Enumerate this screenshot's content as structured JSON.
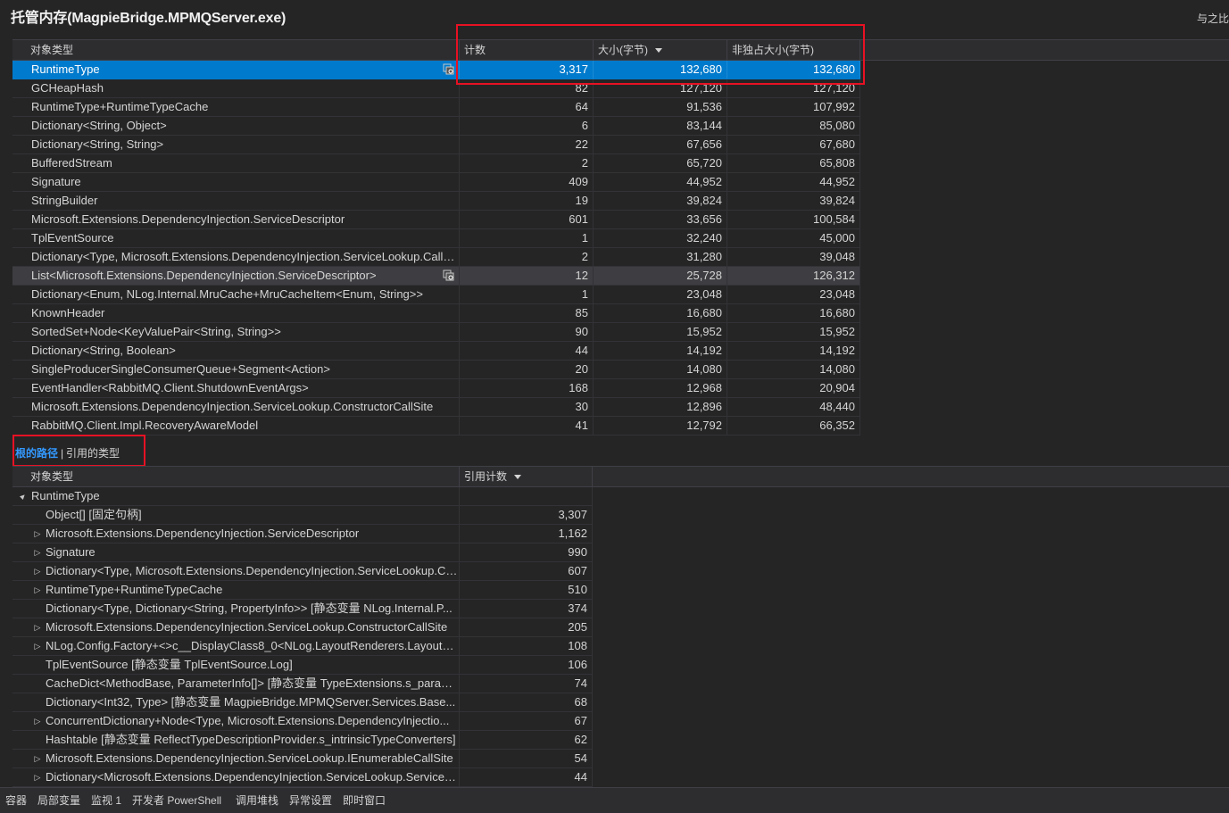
{
  "title": "托管内存(MagpieBridge.MPMQServer.exe)",
  "compare_link": "与之比较",
  "top_grid": {
    "columns": {
      "type": "对象类型",
      "count": "计数",
      "size": "大小(字节)",
      "inclusive": "非独占大小(字节)"
    },
    "rows": [
      {
        "name": "RuntimeType",
        "count": "3,317",
        "size": "132,680",
        "inclusive": "132,680"
      },
      {
        "name": "GCHeapHash",
        "count": "82",
        "size": "127,120",
        "inclusive": "127,120"
      },
      {
        "name": "RuntimeType+RuntimeTypeCache",
        "count": "64",
        "size": "91,536",
        "inclusive": "107,992"
      },
      {
        "name": "Dictionary<String, Object>",
        "count": "6",
        "size": "83,144",
        "inclusive": "85,080"
      },
      {
        "name": "Dictionary<String, String>",
        "count": "22",
        "size": "67,656",
        "inclusive": "67,680"
      },
      {
        "name": "BufferedStream",
        "count": "2",
        "size": "65,720",
        "inclusive": "65,808"
      },
      {
        "name": "Signature",
        "count": "409",
        "size": "44,952",
        "inclusive": "44,952"
      },
      {
        "name": "StringBuilder",
        "count": "19",
        "size": "39,824",
        "inclusive": "39,824"
      },
      {
        "name": "Microsoft.Extensions.DependencyInjection.ServiceDescriptor",
        "count": "601",
        "size": "33,656",
        "inclusive": "100,584"
      },
      {
        "name": "TplEventSource",
        "count": "1",
        "size": "32,240",
        "inclusive": "45,000"
      },
      {
        "name": "Dictionary<Type, Microsoft.Extensions.DependencyInjection.ServiceLookup.CallS...",
        "count": "2",
        "size": "31,280",
        "inclusive": "39,048"
      },
      {
        "name": "List<Microsoft.Extensions.DependencyInjection.ServiceDescriptor>",
        "count": "12",
        "size": "25,728",
        "inclusive": "126,312"
      },
      {
        "name": "Dictionary<Enum, NLog.Internal.MruCache+MruCacheItem<Enum, String>>",
        "count": "1",
        "size": "23,048",
        "inclusive": "23,048"
      },
      {
        "name": "KnownHeader",
        "count": "85",
        "size": "16,680",
        "inclusive": "16,680"
      },
      {
        "name": "SortedSet+Node<KeyValuePair<String, String>>",
        "count": "90",
        "size": "15,952",
        "inclusive": "15,952"
      },
      {
        "name": "Dictionary<String, Boolean>",
        "count": "44",
        "size": "14,192",
        "inclusive": "14,192"
      },
      {
        "name": "SingleProducerSingleConsumerQueue+Segment<Action>",
        "count": "20",
        "size": "14,080",
        "inclusive": "14,080"
      },
      {
        "name": "EventHandler<RabbitMQ.Client.ShutdownEventArgs>",
        "count": "168",
        "size": "12,968",
        "inclusive": "20,904"
      },
      {
        "name": "Microsoft.Extensions.DependencyInjection.ServiceLookup.ConstructorCallSite",
        "count": "30",
        "size": "12,896",
        "inclusive": "48,440"
      },
      {
        "name": "RabbitMQ.Client.Impl.RecoveryAwareModel",
        "count": "41",
        "size": "12,792",
        "inclusive": "66,352"
      }
    ]
  },
  "tabs": {
    "active": "根的路径",
    "separator": "|",
    "inactive": "引用的类型"
  },
  "bottom_grid": {
    "columns": {
      "type": "对象类型",
      "ref_count": "引用计数"
    },
    "rows": [
      {
        "name": "RuntimeType",
        "count": "",
        "expander": "▲",
        "level": 0
      },
      {
        "name": "Object[] [固定句柄]",
        "count": "3,307",
        "expander": "",
        "level": 1
      },
      {
        "name": "Microsoft.Extensions.DependencyInjection.ServiceDescriptor",
        "count": "1,162",
        "expander": "▷",
        "level": 1
      },
      {
        "name": "Signature",
        "count": "990",
        "expander": "▷",
        "level": 1
      },
      {
        "name": "Dictionary<Type, Microsoft.Extensions.DependencyInjection.ServiceLookup.Ca...",
        "count": "607",
        "expander": "▷",
        "level": 1
      },
      {
        "name": "RuntimeType+RuntimeTypeCache",
        "count": "510",
        "expander": "▷",
        "level": 1
      },
      {
        "name": "Dictionary<Type, Dictionary<String, PropertyInfo>> [静态变量 NLog.Internal.P...",
        "count": "374",
        "expander": "",
        "level": 1
      },
      {
        "name": "Microsoft.Extensions.DependencyInjection.ServiceLookup.ConstructorCallSite",
        "count": "205",
        "expander": "▷",
        "level": 1
      },
      {
        "name": "NLog.Config.Factory+<>c__DisplayClass8_0<NLog.LayoutRenderers.LayoutRe...",
        "count": "108",
        "expander": "▷",
        "level": 1
      },
      {
        "name": "TplEventSource [静态变量 TplEventSource.Log]",
        "count": "106",
        "expander": "",
        "level": 1
      },
      {
        "name": "CacheDict<MethodBase, ParameterInfo[]> [静态变量 TypeExtensions.s_paraml...",
        "count": "74",
        "expander": "",
        "level": 1
      },
      {
        "name": "Dictionary<Int32, Type> [静态变量 MagpieBridge.MPMQServer.Services.Base...",
        "count": "68",
        "expander": "",
        "level": 1
      },
      {
        "name": "ConcurrentDictionary+Node<Type, Microsoft.Extensions.DependencyInjectio...",
        "count": "67",
        "expander": "▷",
        "level": 1
      },
      {
        "name": "Hashtable [静态变量 ReflectTypeDescriptionProvider.s_intrinsicTypeConverters]",
        "count": "62",
        "expander": "",
        "level": 1
      },
      {
        "name": "Microsoft.Extensions.DependencyInjection.ServiceLookup.IEnumerableCallSite",
        "count": "54",
        "expander": "▷",
        "level": 1
      },
      {
        "name": "Dictionary<Microsoft.Extensions.DependencyInjection.ServiceLookup.ServiceC...",
        "count": "44",
        "expander": "▷",
        "level": 1
      }
    ]
  },
  "statusbar": [
    "容器",
    "局部变量",
    "监视 1",
    "开发者 PowerShell",
    "调用堆栈",
    "异常设置",
    "即时窗口"
  ],
  "icons": {
    "row_peek": "instances-icon"
  },
  "colors": {
    "background": "#252526",
    "selection": "#007acc",
    "highlight_box": "#e81123",
    "active_tab": "#3399ff"
  }
}
